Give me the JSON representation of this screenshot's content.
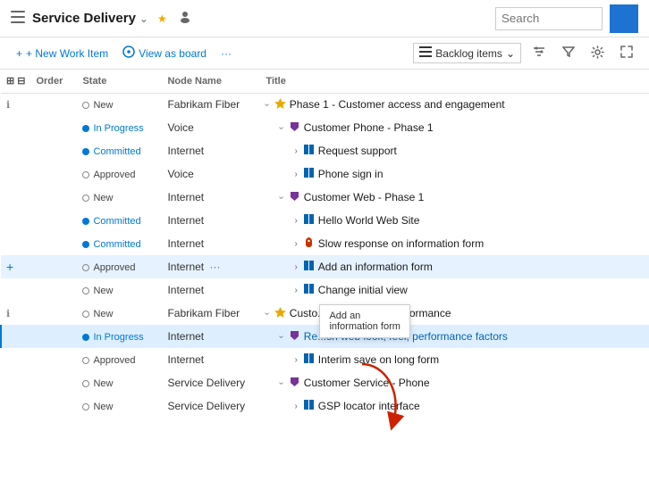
{
  "header": {
    "icon": "≡",
    "title": "Service Delivery",
    "star_label": "★",
    "people_label": "👤",
    "search_placeholder": "Search"
  },
  "toolbar": {
    "new_work_item": "+ New Work Item",
    "view_as_board": "View as board",
    "more_label": "···",
    "backlog_items": "Backlog items",
    "filter_icon": "⊞",
    "settings_icon": "⚙",
    "expand_icon": "⤢"
  },
  "columns": {
    "order": "Order",
    "state": "State",
    "node_name": "Node Name",
    "title": "Title"
  },
  "rows": [
    {
      "id": 1,
      "indent": 1,
      "info": true,
      "order": "",
      "state": "New",
      "state_type": "new",
      "node": "Fabrikam Fiber",
      "expand": "down",
      "icon": "epic",
      "title": "Phase 1 - Customer access and engagement"
    },
    {
      "id": 2,
      "indent": 2,
      "order": "",
      "state": "In Progress",
      "state_type": "inprogress",
      "node": "Voice",
      "expand": "down",
      "icon": "feature",
      "title": "Customer Phone - Phase 1"
    },
    {
      "id": 3,
      "indent": 3,
      "order": "",
      "state": "Committed",
      "state_type": "committed",
      "node": "Internet",
      "expand": "right",
      "icon": "story",
      "title": "Request support"
    },
    {
      "id": 4,
      "indent": 3,
      "order": "",
      "state": "Approved",
      "state_type": "approved",
      "node": "Voice",
      "expand": "right",
      "icon": "story",
      "title": "Phone sign in"
    },
    {
      "id": 5,
      "indent": 2,
      "order": "",
      "state": "New",
      "state_type": "new",
      "node": "Internet",
      "expand": "down",
      "icon": "feature",
      "title": "Customer Web - Phase 1"
    },
    {
      "id": 6,
      "indent": 3,
      "order": "",
      "state": "Committed",
      "state_type": "committed",
      "node": "Internet",
      "expand": "right",
      "icon": "story",
      "title": "Hello World Web Site"
    },
    {
      "id": 7,
      "indent": 3,
      "order": "",
      "state": "Committed",
      "state_type": "committed",
      "node": "Internet",
      "expand": "right",
      "icon": "bug",
      "title": "Slow response on information form"
    },
    {
      "id": 8,
      "indent": 3,
      "add": true,
      "order": "",
      "state": "Approved",
      "state_type": "approved",
      "node": "Internet",
      "ellipsis": true,
      "expand": "right",
      "icon": "story",
      "title": "Add an information form",
      "highlighted": true
    },
    {
      "id": 9,
      "indent": 3,
      "order": "",
      "state": "New",
      "state_type": "new",
      "node": "Internet",
      "expand": "right",
      "icon": "story",
      "title": "Change initial view"
    },
    {
      "id": 10,
      "indent": 1,
      "info": true,
      "order": "",
      "state": "New",
      "state_type": "new",
      "node": "Fabrikam Fiber",
      "expand": "down",
      "icon": "epic",
      "title": "Custo... - improve UI performance",
      "tooltip": true
    },
    {
      "id": 11,
      "indent": 2,
      "order": "",
      "state": "In Progress",
      "state_type": "inprogress",
      "node": "Internet",
      "expand": "down",
      "icon": "feature",
      "title": "Re...sh web look, feel, performance factors",
      "active": true
    },
    {
      "id": 12,
      "indent": 3,
      "order": "",
      "state": "Approved",
      "state_type": "approved",
      "node": "Internet",
      "expand": "right",
      "icon": "story",
      "title": "Interim save on long form"
    },
    {
      "id": 13,
      "indent": 2,
      "order": "",
      "state": "New",
      "state_type": "new",
      "node": "Service Delivery",
      "expand": "down",
      "icon": "feature",
      "title": "Customer Service - Phone"
    },
    {
      "id": 14,
      "indent": 3,
      "order": "",
      "state": "New",
      "state_type": "new",
      "node": "Service Delivery",
      "expand": "right",
      "icon": "story",
      "title": "GSP locator interface"
    }
  ],
  "tooltip": {
    "line1": "Add an",
    "line2": "information form"
  },
  "icons": {
    "epic": "♛",
    "feature": "🏆",
    "story": "▐▌",
    "bug": "☁"
  }
}
